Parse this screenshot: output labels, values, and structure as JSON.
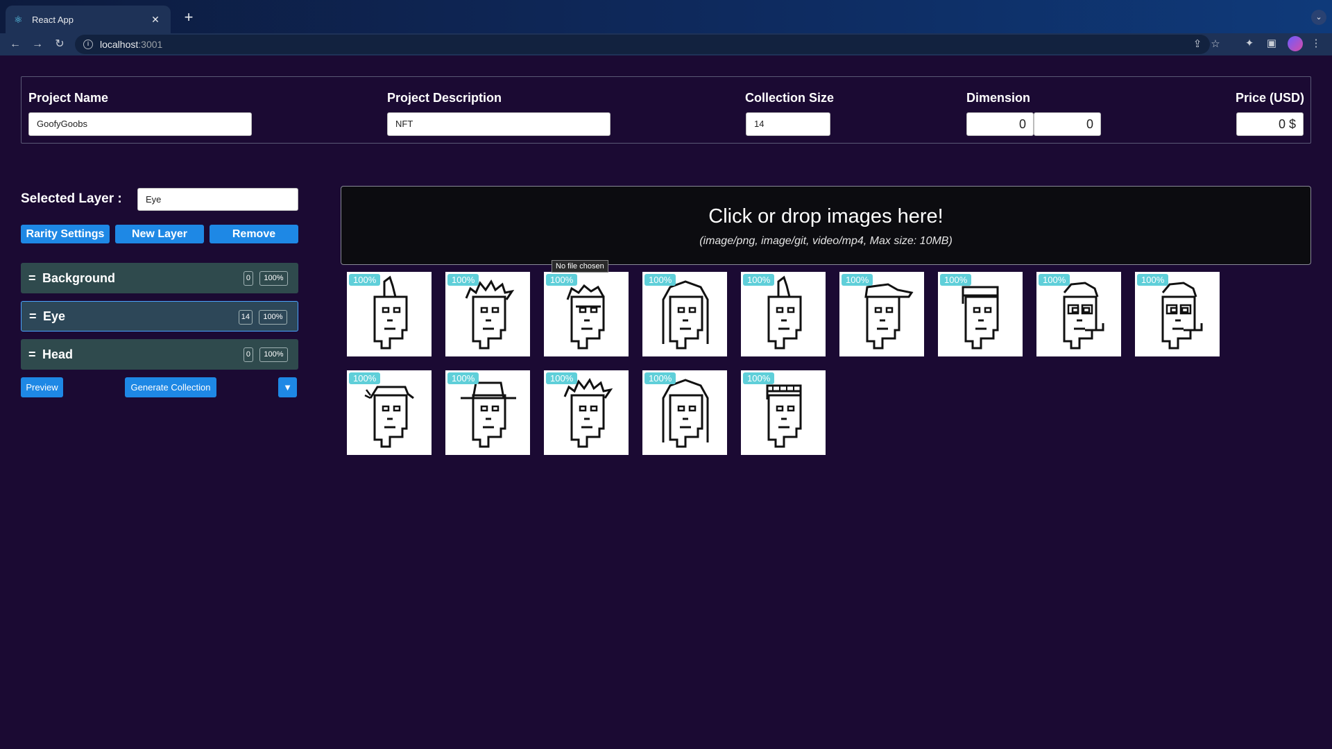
{
  "browser": {
    "tab_title": "React App",
    "url_host": "localhost",
    "url_port": ":3001"
  },
  "project": {
    "name_label": "Project Name",
    "name_value": "GoofyGoobs",
    "description_label": "Project Description",
    "description_value": "NFT",
    "size_label": "Collection Size",
    "size_value": "14",
    "dimension_label": "Dimension",
    "dimension_width": "0",
    "dimension_height": "0",
    "price_label": "Price (USD)",
    "price_value": "0 $"
  },
  "layers_panel": {
    "selected_label": "Selected Layer :",
    "selected_value": "Eye",
    "rarity_button": "Rarity Settings",
    "new_layer_button": "New Layer",
    "remove_button": "Remove",
    "layers": [
      {
        "handle": "=",
        "name": "Background",
        "count": "0",
        "rarity": "100%"
      },
      {
        "handle": "=",
        "name": "Eye",
        "count": "14",
        "rarity": "100%"
      },
      {
        "handle": "=",
        "name": "Head",
        "count": "0",
        "rarity": "100%"
      }
    ],
    "preview_button": "Preview",
    "generate_button": "Generate Collection",
    "dropdown_glyph": "▼"
  },
  "dropzone": {
    "title": "Click or drop images here!",
    "subtitle": "(image/png, image/git, video/mp4, Max size: 10MB)",
    "tooltip": "No file chosen"
  },
  "images": [
    {
      "badge": "100%",
      "icon": "punk-mohawk"
    },
    {
      "badge": "100%",
      "icon": "punk-wild-hair"
    },
    {
      "badge": "100%",
      "icon": "punk-messy-glasses"
    },
    {
      "badge": "100%",
      "icon": "punk-long-hair"
    },
    {
      "badge": "100%",
      "icon": "punk-mohawk"
    },
    {
      "badge": "100%",
      "icon": "punk-cap"
    },
    {
      "badge": "100%",
      "icon": "punk-beanie"
    },
    {
      "badge": "100%",
      "icon": "punk-glasses-pipe"
    },
    {
      "badge": "100%",
      "icon": "punk-glasses-pipe"
    },
    {
      "badge": "100%",
      "icon": "punk-bandana"
    },
    {
      "badge": "100%",
      "icon": "punk-cowboy-hat"
    },
    {
      "badge": "100%",
      "icon": "punk-wild-hair"
    },
    {
      "badge": "100%",
      "icon": "punk-long-hair"
    },
    {
      "badge": "100%",
      "icon": "punk-headband"
    }
  ]
}
